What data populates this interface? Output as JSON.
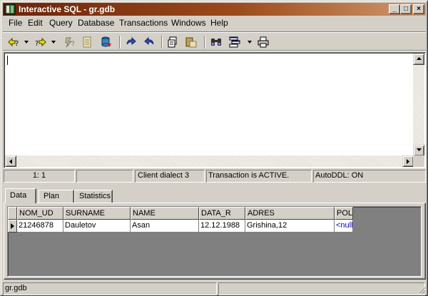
{
  "window": {
    "title": "Interactive SQL - gr.gdb",
    "caption_buttons": {
      "minimize": "_",
      "maximize": "□",
      "close": "×"
    }
  },
  "menu": [
    "File",
    "Edit",
    "Query",
    "Database",
    "Transactions",
    "Windows",
    "Help"
  ],
  "toolbar": {
    "buttons": [
      "previous-query-icon",
      "next-query-icon",
      "execute-query-icon",
      "query-options-icon",
      "commit-icon",
      "rollback-icon",
      "cut-icon",
      "copy-icon",
      "paste-icon",
      "find-icon",
      "window-list-icon",
      "print-icon"
    ]
  },
  "editor": {
    "text": ""
  },
  "editor_status": {
    "position": "1:   1",
    "dialect": "Client dialect 3",
    "transaction": "Transaction is ACTIVE.",
    "autoddl": "AutoDDL: ON"
  },
  "tabs": [
    "Data",
    "Plan",
    "Statistics"
  ],
  "grid": {
    "columns": [
      "NOM_UD",
      "SURNAME",
      "NAME",
      "DATA_R",
      "ADRES",
      "POL"
    ],
    "rows": [
      [
        "21246878",
        "Dauletov",
        "Asan",
        "12.12.1988",
        "Grishina,12",
        "<null>"
      ]
    ]
  },
  "statusbar": {
    "file": "gr.gdb"
  },
  "colors": {
    "title_start": "#6a240a",
    "title_end": "#d09a6c",
    "null_text": "#0000cc"
  }
}
